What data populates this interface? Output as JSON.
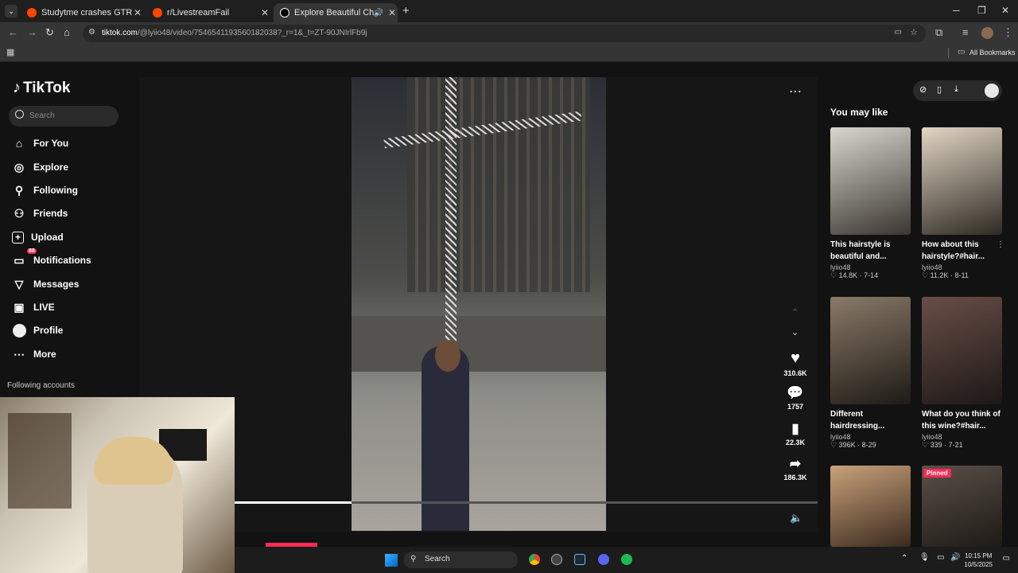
{
  "browser": {
    "tabs": [
      {
        "title": "Studytme crashes GTR at car m"
      },
      {
        "title": "r/LivestreamFail"
      },
      {
        "title": "Explore Beautiful Chinese H"
      }
    ],
    "url_host": "tiktok.com",
    "url_rest": "/@lyiio48/video/7546541193560182038?_r=1&_t=ZT-90JNIrlFb9j",
    "bookmarks_label": "All Bookmarks"
  },
  "tiktok": {
    "logo_text": "TikTok",
    "search_placeholder": "Search",
    "nav": [
      {
        "label": "For You",
        "icon": "home-icon"
      },
      {
        "label": "Explore",
        "icon": "compass-icon"
      },
      {
        "label": "Following",
        "icon": "following-icon"
      },
      {
        "label": "Friends",
        "icon": "friends-icon"
      },
      {
        "label": "Upload",
        "icon": "upload-icon"
      },
      {
        "label": "Notifications",
        "icon": "notifications-icon",
        "badge": "88"
      },
      {
        "label": "Messages",
        "icon": "messages-icon"
      },
      {
        "label": "LIVE",
        "icon": "live-icon"
      },
      {
        "label": "Profile",
        "icon": "profile-icon"
      },
      {
        "label": "More",
        "icon": "more-icon"
      }
    ],
    "following_accounts_label": "Following accounts",
    "actions": {
      "likes": "310.6K",
      "comments": "1757",
      "saves": "22.3K",
      "shares": "186.3K"
    },
    "progress": 0.2,
    "you_may_like_title": "You may like",
    "suggestions": [
      {
        "title_1": "This hairstyle is",
        "title_2": "beautiful and...",
        "user": "lyiio48",
        "likes": "14.8K",
        "date": "7-14"
      },
      {
        "title_1": "How about this",
        "title_2": "hairstyle?#hair...",
        "user": "lyiio48",
        "likes": "11.2K",
        "date": "8-11"
      },
      {
        "title_1": "Different",
        "title_2": "hairdressing...",
        "user": "lyiio48",
        "likes": "396K",
        "date": "8-29"
      },
      {
        "title_1": "What do you think of",
        "title_2": "this wine?#hair...",
        "user": "lyiio48",
        "likes": "339",
        "date": "7-21"
      },
      {
        "pinned": ""
      },
      {
        "pinned": "Pinned"
      }
    ]
  },
  "taskbar": {
    "search_label": "Search",
    "time": "10:15 PM",
    "date": "10/5/2025"
  },
  "colors": {
    "accent": "#fe2c55",
    "bg": "#121212"
  }
}
